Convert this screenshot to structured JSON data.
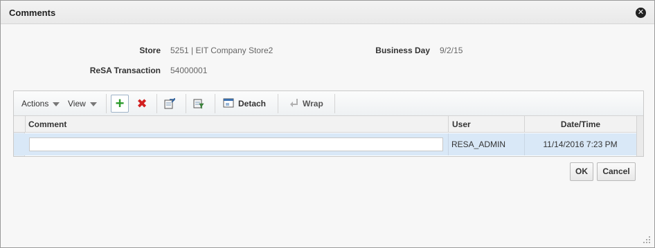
{
  "dialog": {
    "title": "Comments",
    "close_icon": "close-circle-icon"
  },
  "fields": {
    "store_label": "Store",
    "store_value": "5251 | EIT Company Store2",
    "business_day_label": "Business Day",
    "business_day_value": "9/2/15",
    "resa_label": "ReSA Transaction",
    "resa_value": "54000001"
  },
  "toolbar": {
    "actions_label": "Actions",
    "view_label": "View",
    "add_icon": "add-plus-icon",
    "delete_icon": "delete-x-icon",
    "export_icon": "export-icon",
    "query_icon": "query-by-example-icon",
    "detach_label": "Detach",
    "wrap_label": "Wrap"
  },
  "table": {
    "columns": [
      "Comment",
      "User",
      "Date/Time"
    ],
    "rows": [
      {
        "comment": "",
        "user": "RESA_ADMIN",
        "datetime": "11/14/2016 7:23 PM"
      }
    ]
  },
  "buttons": {
    "ok_label": "OK",
    "cancel_label": "Cancel"
  }
}
